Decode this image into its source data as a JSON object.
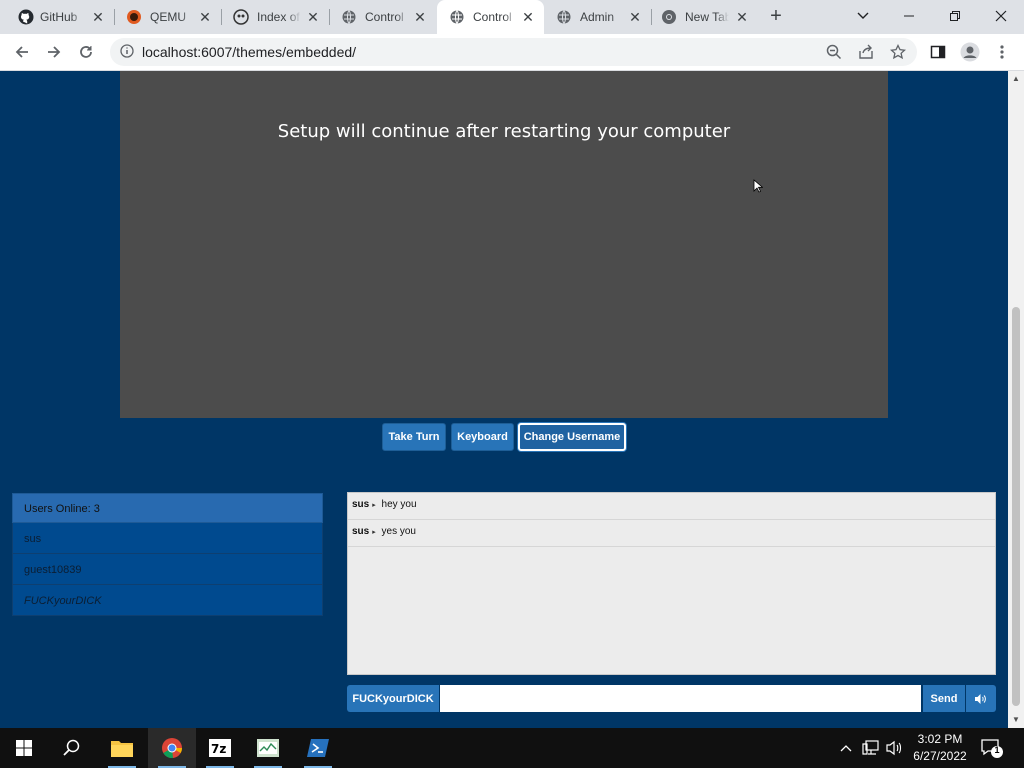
{
  "browser": {
    "tabs": [
      {
        "title": "GitHub",
        "icon": "github-icon",
        "active": false
      },
      {
        "title": "QEMU",
        "icon": "qemu-icon",
        "active": false
      },
      {
        "title": "Index of",
        "icon": "index-icon",
        "active": false
      },
      {
        "title": "Control",
        "icon": "globe-icon",
        "active": false
      },
      {
        "title": "Control",
        "icon": "globe-icon",
        "active": true
      },
      {
        "title": "Admin",
        "icon": "globe-icon",
        "active": false
      },
      {
        "title": "New Tab",
        "icon": "chrome-icon",
        "active": false
      }
    ],
    "url": "localhost:6007/themes/embedded/"
  },
  "vm": {
    "screen_text": "Setup will continue after restarting your computer"
  },
  "controls": {
    "take_turn": "Take Turn",
    "keyboard": "Keyboard",
    "change_username": "Change Username"
  },
  "users": {
    "header": "Users Online: 3",
    "list": [
      "sus",
      "guest10839",
      "FUCKyourDICK"
    ]
  },
  "chat": {
    "messages": [
      {
        "nick": "sus",
        "text": "hey you"
      },
      {
        "nick": "sus",
        "text": "yes you"
      }
    ],
    "username": "FUCKyourDICK",
    "input_value": "",
    "send_label": "Send"
  },
  "taskbar": {
    "time": "3:02 PM",
    "date": "6/27/2022",
    "notification_count": "1"
  },
  "colors": {
    "page_bg": "#003666",
    "button_blue": "#2874b8",
    "vm_bg": "#4c4c4c"
  }
}
